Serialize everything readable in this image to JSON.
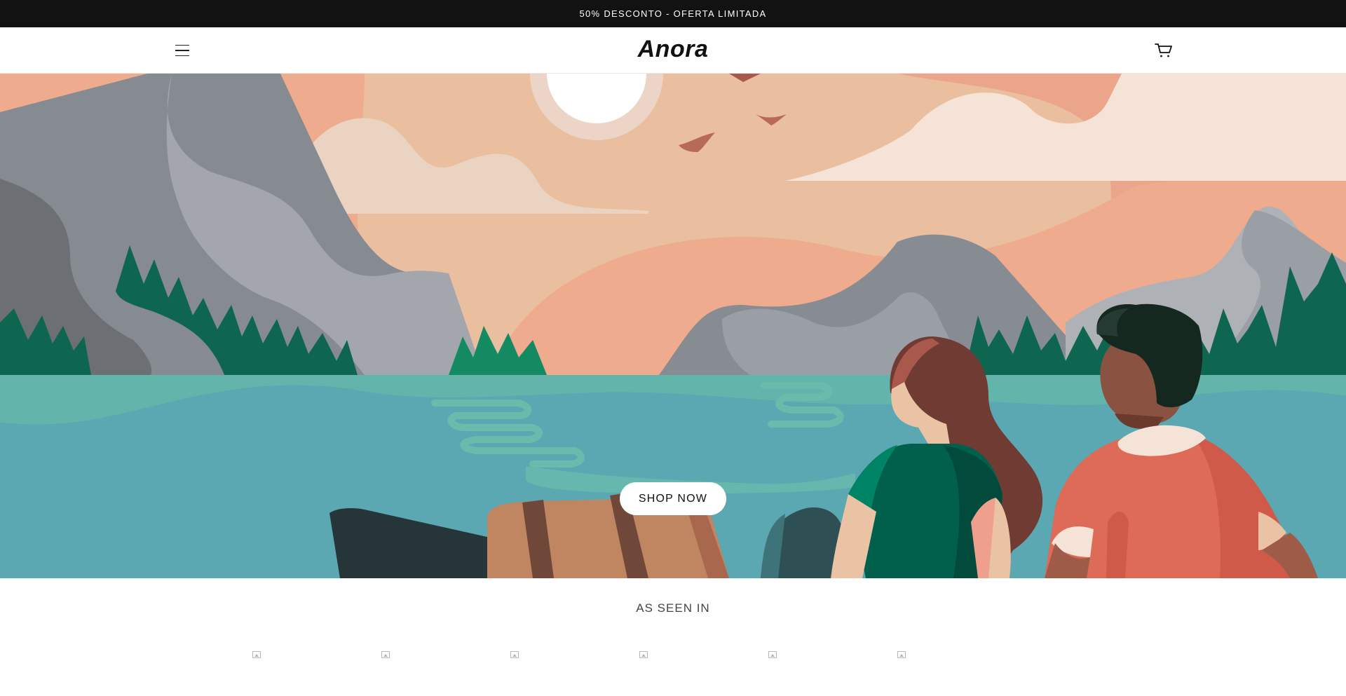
{
  "announcement": {
    "text": "50% DESCONTO - OFERTA LIMITADA"
  },
  "header": {
    "logo_text": "Anora",
    "menu_icon": "hamburger-menu-icon",
    "cart_icon": "cart-icon"
  },
  "hero": {
    "cta_label": "SHOP NOW",
    "illustration": "lake-landscape-couple-illustration"
  },
  "as_seen_in": {
    "title": "AS SEEN IN",
    "logos": [
      {
        "icon": "broken-image-icon"
      },
      {
        "icon": "broken-image-icon"
      },
      {
        "icon": "broken-image-icon"
      },
      {
        "icon": "broken-image-icon"
      },
      {
        "icon": "broken-image-icon"
      },
      {
        "icon": "broken-image-icon"
      }
    ]
  },
  "colors": {
    "announcement_bg": "#121212",
    "sky": "#e9bfa0",
    "lake": "#5ba8b2",
    "forest": "#0f6650"
  }
}
